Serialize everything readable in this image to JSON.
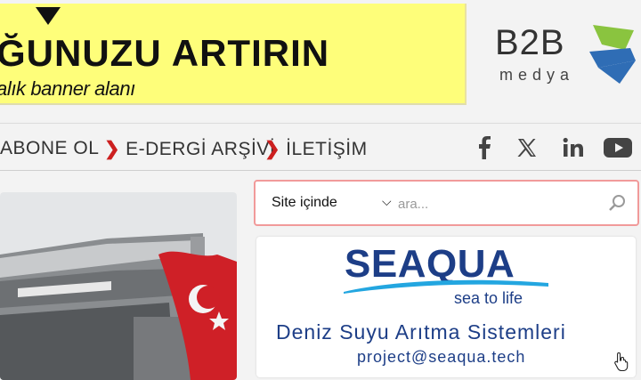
{
  "banner": {
    "headline": "ĞUNUZU ARTIRIN",
    "subtext": "alık banner alanı",
    "background": "#fefe7a"
  },
  "logo": {
    "name": "B2B",
    "sub": "medya",
    "colors": {
      "green": "#8ac43f",
      "blue": "#2f6db5"
    }
  },
  "nav": {
    "items": [
      {
        "label": "ABONE OL"
      },
      {
        "label": "E-DERGİ ARŞİVİ"
      },
      {
        "label": "İLETİŞİM"
      }
    ],
    "chevron_color": "#cc1f1f",
    "social": [
      "facebook-icon",
      "x-icon",
      "linkedin-icon",
      "youtube-icon"
    ]
  },
  "search": {
    "scope_value": "Site içinde",
    "placeholder": "ara...",
    "border_color": "#f19a9a"
  },
  "ad": {
    "brand": "SEAQUA",
    "tagline": "sea to life",
    "title": "Deniz Suyu Arıtma Sistemleri",
    "email": "project@seaqua.tech",
    "color": "#1d3e87"
  }
}
